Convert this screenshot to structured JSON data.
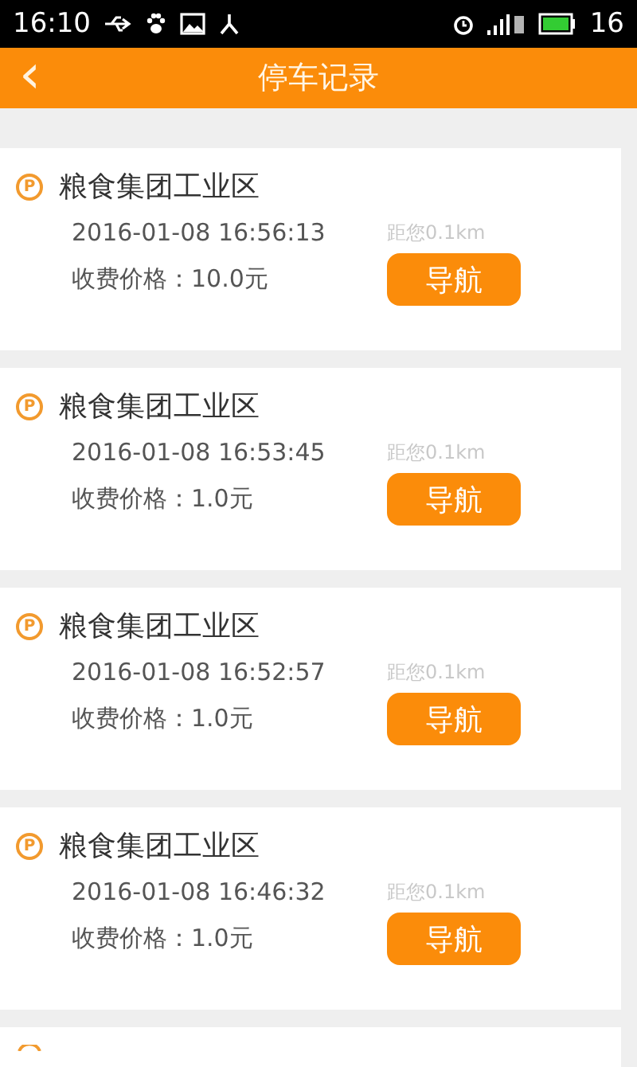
{
  "status_bar": {
    "time": "16:10",
    "battery": "16"
  },
  "header": {
    "back": "‹",
    "title": "停车记录"
  },
  "records": [
    {
      "badge": "P",
      "name": "粮食集团工业区",
      "time": "2016-01-08 16:56:13",
      "distance": "距您0.1km",
      "price": "收费价格：10.0元",
      "action": "导航"
    },
    {
      "badge": "P",
      "name": "粮食集团工业区",
      "time": "2016-01-08 16:53:45",
      "distance": "距您0.1km",
      "price": "收费价格：1.0元",
      "action": "导航"
    },
    {
      "badge": "P",
      "name": "粮食集团工业区",
      "time": "2016-01-08 16:52:57",
      "distance": "距您0.1km",
      "price": "收费价格：1.0元",
      "action": "导航"
    },
    {
      "badge": "P",
      "name": "粮食集团工业区",
      "time": "2016-01-08 16:46:32",
      "distance": "距您0.1km",
      "price": "收费价格：1.0元",
      "action": "导航"
    }
  ],
  "more_below": true
}
